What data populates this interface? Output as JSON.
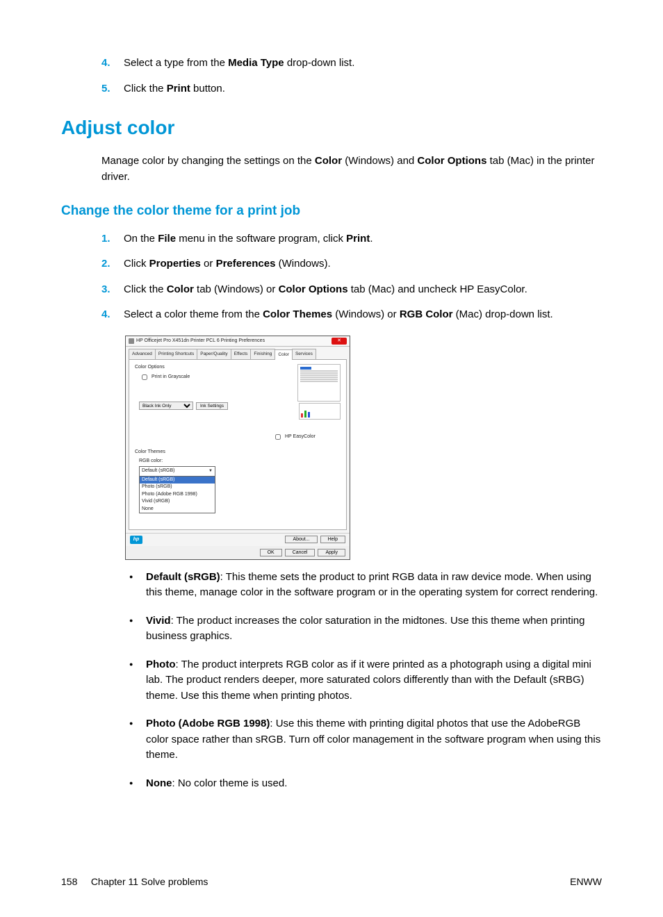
{
  "top_steps": [
    {
      "num": "4.",
      "parts": [
        "Select a type from the ",
        {
          "b": "Media Type"
        },
        " drop-down list."
      ]
    },
    {
      "num": "5.",
      "parts": [
        "Click the ",
        {
          "b": "Print"
        },
        " button."
      ]
    }
  ],
  "h1": "Adjust color",
  "intro": {
    "parts": [
      "Manage color by changing the settings on the ",
      {
        "b": "Color"
      },
      " (Windows) and ",
      {
        "b": "Color Options"
      },
      " tab (Mac) in the printer driver."
    ]
  },
  "h2": "Change the color theme for a print job",
  "steps2": [
    {
      "num": "1.",
      "parts": [
        "On the ",
        {
          "b": "File"
        },
        " menu in the software program, click ",
        {
          "b": "Print"
        },
        "."
      ]
    },
    {
      "num": "2.",
      "parts": [
        "Click ",
        {
          "b": "Properties"
        },
        " or ",
        {
          "b": "Preferences"
        },
        " (Windows)."
      ]
    },
    {
      "num": "3.",
      "parts": [
        "Click the ",
        {
          "b": "Color"
        },
        " tab (Windows) or ",
        {
          "b": "Color Options"
        },
        " tab (Mac) and uncheck HP EasyColor."
      ]
    },
    {
      "num": "4.",
      "parts": [
        "Select a color theme from the ",
        {
          "b": "Color Themes"
        },
        " (Windows) or ",
        {
          "b": "RGB Color"
        },
        " (Mac) drop-down list."
      ]
    }
  ],
  "dialog": {
    "title": "HP Officejet Pro X451dn Printer PCL 6 Printing Preferences",
    "tabs": [
      "Advanced",
      "Printing Shortcuts",
      "Paper/Quality",
      "Effects",
      "Finishing",
      "Color",
      "Services"
    ],
    "active_tab": "Color",
    "color_options_label": "Color Options",
    "grayscale_label": "Print in Grayscale",
    "ink_select": "Black Ink Only",
    "ink_settings_btn": "Ink Settings",
    "easycolor_label": "HP EasyColor",
    "themes_label": "Color Themes",
    "rgb_label": "RGB color:",
    "combo_selected": "Default (sRGB)",
    "combo_items": [
      "Default (sRGB)",
      "Photo (sRGB)",
      "Photo (Adobe RGB 1998)",
      "Vivid (sRGB)",
      "None"
    ],
    "about_btn": "About...",
    "help_btn": "Help",
    "ok_btn": "OK",
    "cancel_btn": "Cancel",
    "apply_btn": "Apply"
  },
  "bullets": [
    {
      "parts": [
        {
          "b": "Default (sRGB)"
        },
        ": This theme sets the product to print RGB data in raw device mode. When using this theme, manage color in the software program or in the operating system for correct rendering."
      ]
    },
    {
      "parts": [
        {
          "b": "Vivid"
        },
        ": The product increases the color saturation in the midtones. Use this theme when printing business graphics."
      ]
    },
    {
      "parts": [
        {
          "b": "Photo"
        },
        ": The product interprets RGB color as if it were printed as a photograph using a digital mini lab. The product renders deeper, more saturated colors differently than with the Default (sRBG) theme. Use this theme when printing photos."
      ]
    },
    {
      "parts": [
        {
          "b": "Photo (Adobe RGB 1998)"
        },
        ": Use this theme with printing digital photos that use the AdobeRGB color space rather than sRGB. Turn off color management in the software program when using this theme."
      ]
    },
    {
      "parts": [
        {
          "b": "None"
        },
        ": No color theme is used."
      ]
    }
  ],
  "footer": {
    "page": "158",
    "chapter": "Chapter 11   Solve problems",
    "right": "ENWW"
  }
}
